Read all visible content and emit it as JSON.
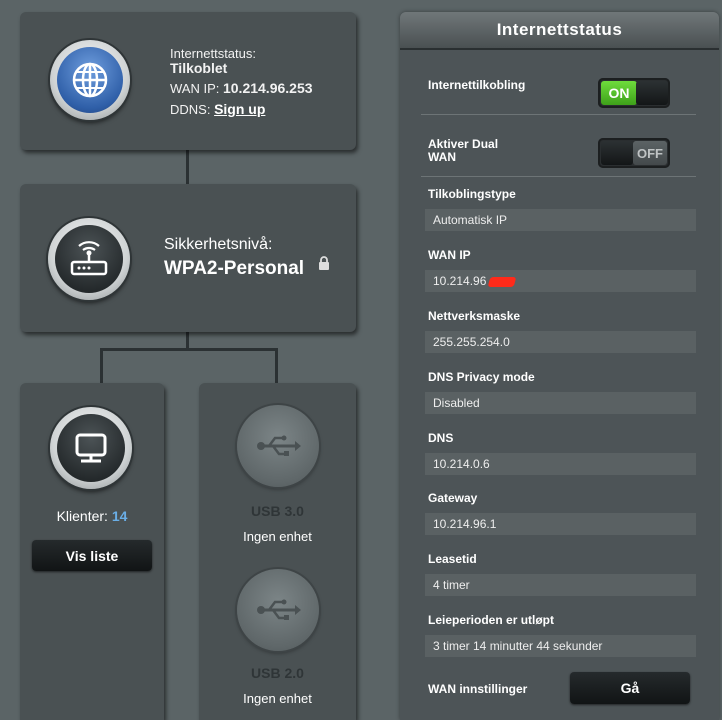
{
  "internet_card": {
    "status_label": "Internettstatus:",
    "status_value": "Tilkoblet",
    "wan_label": "WAN IP:",
    "wan_value": "10.214.96.253",
    "ddns_label": "DDNS:",
    "ddns_link": "Sign up"
  },
  "router_card": {
    "security_label": "Sikkerhetsnivå:",
    "security_value": "WPA2-Personal"
  },
  "clients_card": {
    "label": "Klienter:",
    "count": "14",
    "button": "Vis liste"
  },
  "usb_card": {
    "usb3_label": "USB 3.0",
    "usb3_status": "Ingen enhet",
    "usb2_label": "USB 2.0",
    "usb2_status": "Ingen enhet"
  },
  "panel": {
    "title": "Internettstatus",
    "internet_connection": {
      "label": "Internettilkobling",
      "state": "ON"
    },
    "dual_wan": {
      "label_line1": "Aktiver Dual",
      "label_line2": "WAN",
      "state": "OFF"
    },
    "rows": [
      {
        "label": "Tilkoblingstype",
        "value": "Automatisk IP"
      },
      {
        "label": "WAN IP",
        "value": "10.214.96"
      },
      {
        "label": "Nettverksmaske",
        "value": "255.255.254.0"
      },
      {
        "label": "DNS Privacy mode",
        "value": "Disabled"
      },
      {
        "label": "DNS",
        "value": "10.214.0.6"
      },
      {
        "label": "Gateway",
        "value": "10.214.96.1"
      },
      {
        "label": "Leasetid",
        "value": "4 timer"
      },
      {
        "label": "Leieperioden er utløpt",
        "value": "3 timer 14 minutter 44 sekunder"
      }
    ],
    "wan_settings": {
      "label": "WAN innstillinger",
      "button": "Gå"
    }
  },
  "colors": {
    "background": "#5b6466",
    "card": "#4a5153",
    "toggle_on": "#4cb924",
    "client_count": "#6aaee6",
    "redaction": "#ff2a1a"
  }
}
